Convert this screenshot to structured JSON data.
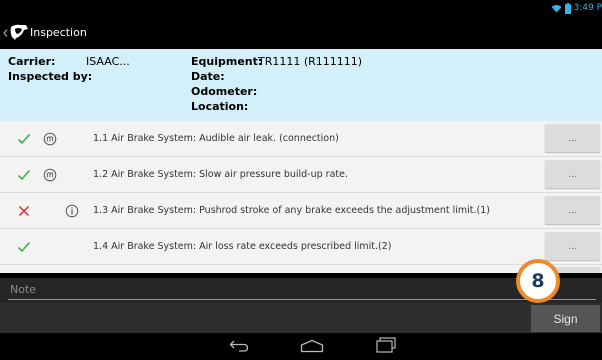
{
  "status_bar": {
    "time": "3:49 P",
    "icons": [
      "wifi-icon",
      "battery-icon"
    ]
  },
  "app": {
    "title": "Inspection"
  },
  "info": {
    "carrier_label": "Carrier:",
    "carrier_value": "ISAAC...",
    "inspected_by_label": "Inspected by:",
    "equipment_label": "Equipment:",
    "equipment_value": "TR1111 (R111111)",
    "date_label": "Date:",
    "odometer_label": "Odometer:",
    "location_label": "Location:"
  },
  "items": [
    {
      "status": "pass",
      "status_icon": "check-icon",
      "mark_icon": "m-circle-icon",
      "text": "1.1 Air Brake System: Audible air leak. (connection)",
      "button": "..."
    },
    {
      "status": "pass",
      "status_icon": "check-icon",
      "mark_icon": "m-circle-icon",
      "text": "1.2 Air Brake System: Slow air pressure build-up rate.",
      "button": "..."
    },
    {
      "status": "fail",
      "status_icon": "x-icon",
      "mark_icon": "info-circle-icon",
      "text": "1.3 Air Brake System: Pushrod stroke of any brake exceeds the adjustment limit.(1)",
      "button": "..."
    },
    {
      "status": "pass",
      "status_icon": "check-icon",
      "mark_icon": null,
      "text": "1.4 Air Brake System: Air loss rate exceeds prescribed limit.(2)",
      "button": "..."
    }
  ],
  "note": {
    "placeholder": "Note",
    "value": ""
  },
  "sign": {
    "label": "Sign"
  },
  "badge": {
    "label": "8"
  },
  "colors": {
    "accent": "#34b5e5",
    "info_bg": "#d2effa",
    "pass": "#3fae49",
    "fail": "#e0302a",
    "badge_ring": "#f0892a"
  },
  "nav_bar": {
    "icons": [
      "back-nav-icon",
      "home-nav-icon",
      "recent-apps-icon"
    ]
  }
}
